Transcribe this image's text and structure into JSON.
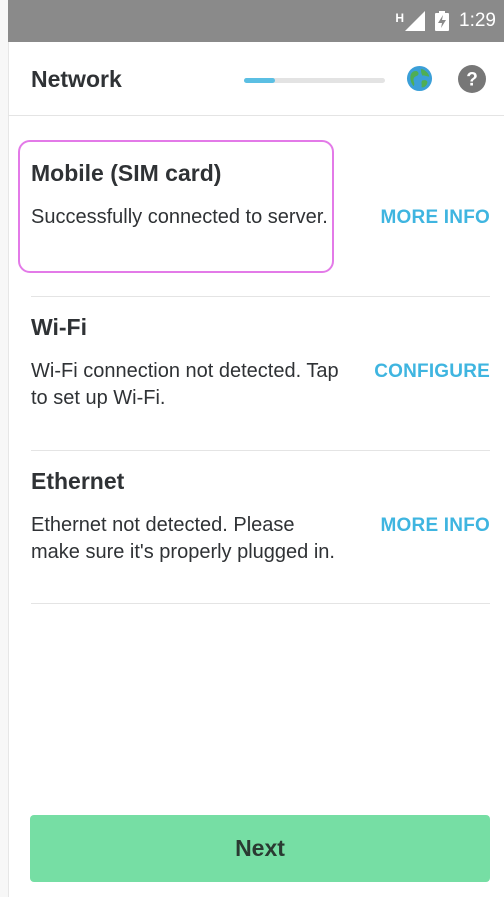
{
  "status_bar": {
    "network_type": "H",
    "time": "1:29"
  },
  "header": {
    "title": "Network",
    "progress_fraction": 0.22,
    "icons": [
      "globe-icon",
      "help-icon"
    ],
    "help_glyph": "?"
  },
  "networks": [
    {
      "title": "Mobile (SIM card)",
      "description": "Successfully connected to server.",
      "action": "MORE INFO",
      "focused": true
    },
    {
      "title": "Wi-Fi",
      "description": "Wi-Fi connection not detected. Tap to set up Wi-Fi.",
      "action": "CONFIGURE"
    },
    {
      "title": "Ethernet",
      "description": "Ethernet not detected. Please make sure it's properly plugged in.",
      "action": "MORE INFO"
    }
  ],
  "footer": {
    "next_label": "Next"
  },
  "colors": {
    "accent": "#3fb5e0",
    "progress": "#5bbfe3",
    "next_button": "#76dea4",
    "focus_ring": "#e37ae8",
    "status_bar": "#8a8a8a"
  }
}
